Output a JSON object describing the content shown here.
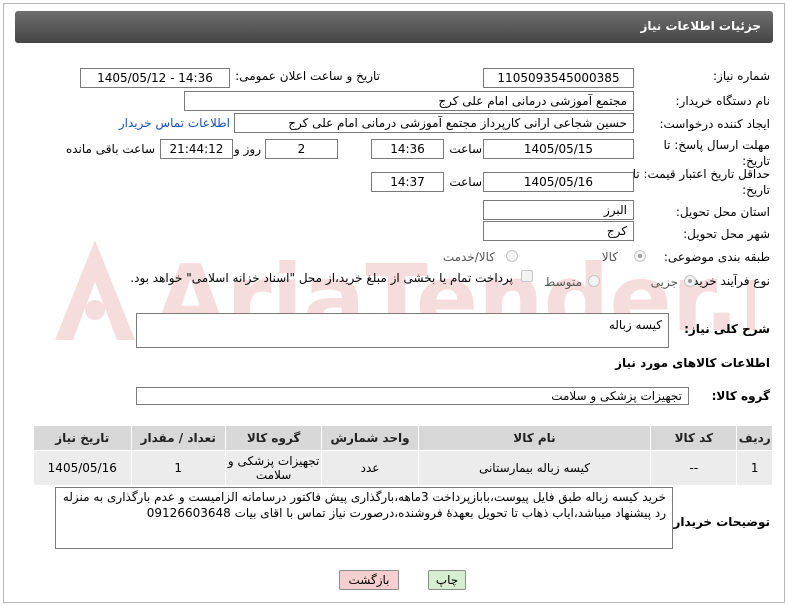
{
  "header": {
    "title": "جزئیات اطلاعات نیاز"
  },
  "fields": {
    "need_number_label": "شماره نیاز:",
    "need_number": "1105093545000385",
    "announce_label": "تاریخ و ساعت اعلان عمومی:",
    "announce_value": "1405/05/12 - 14:36",
    "buyer_org_label": "نام دستگاه خریدار:",
    "buyer_org": "مجتمع آموزشی درمانی امام علی کرج",
    "creator_label": "ایجاد کننده درخواست:",
    "creator": "حسین شجاعی ارانی کارپرداز مجتمع آموزشی درمانی امام علی کرج",
    "contact_link": "اطلاعات تماس خریدار",
    "reply_deadline_label": "مهلت ارسال پاسخ: تا تاریخ:",
    "reply_date": "1405/05/15",
    "time_word": "ساعت",
    "reply_time": "14:36",
    "days": "2",
    "days_word": "روز و",
    "remaining_time": "21:44:12",
    "remaining_word": "ساعت باقی مانده",
    "price_deadline_label": "حداقل تاریخ اعتبار قیمت: تا تاریخ:",
    "price_date": "1405/05/16",
    "price_time": "14:37",
    "province_label": "استان محل تحویل:",
    "province": "البرز",
    "city_label": "شهر محل تحویل:",
    "city": "کرج",
    "category_label": "طبقه بندی موضوعی:",
    "category_options": [
      "کالا",
      "کالا/خدمت"
    ],
    "purchase_type_label": "نوع فرآیند خرید :",
    "purchase_options": [
      "جزیی",
      "متوسط"
    ],
    "payment_note": "پرداخت تمام یا بخشی از مبلغ خرید،از محل \"اسناد خزانه اسلامی\" خواهد بود.",
    "description_label": "شرح کلی نیاز:",
    "description": "کیسه زباله",
    "goods_info_label": "اطلاعات کالاهای مورد نیاز",
    "goods_group_label": "گروه کالا:",
    "goods_group": "تجهیزات پزشکی و سلامت",
    "buyer_notes_label": "توضیحات خریدار:",
    "buyer_notes": "خرید کیسه زباله طبق فایل پیوست،بابازپرداخت 3ماهه،بارگذاری پیش فاکتور درسامانه الزامیست و عدم بارگذاری به منزله رد پیشنهاد میباشد،ایاب ذهاب تا تحویل بعهدهٔ فروشنده،درصورت نیاز تماس با اقای بیات 09126603648"
  },
  "table": {
    "headers": [
      "ردیف",
      "کد کالا",
      "نام کالا",
      "واحد شمارش",
      "گروه کالا",
      "تعداد / مقدار",
      "تاریخ نیاز"
    ],
    "rows": [
      [
        "1",
        "--",
        "کیسه زباله بیمارستانی",
        "عدد",
        "تجهیزات پزشکی و سلامت",
        "1",
        "1405/05/16"
      ]
    ]
  },
  "buttons": {
    "print": "چاپ",
    "back": "بازگشت"
  },
  "watermark": {
    "text": "AriaTender.neT"
  },
  "colors": {
    "title_bg": "#555555",
    "link": "#1a4fb5",
    "back_bg": "#f6d0d0",
    "print_bg": "#d6efd0"
  }
}
